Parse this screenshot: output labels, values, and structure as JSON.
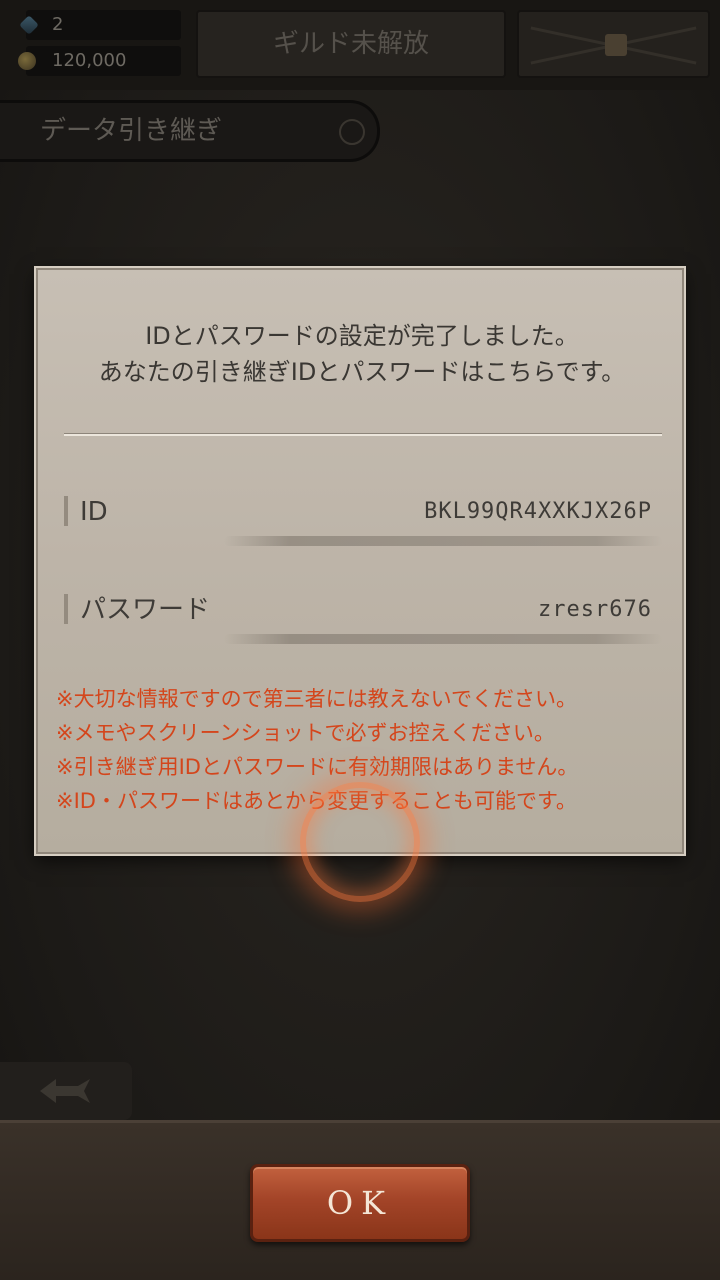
{
  "header": {
    "gems": "2",
    "gold": "120,000",
    "guild_label": "ギルド未解放"
  },
  "page_title": "データ引き継ぎ",
  "dialog": {
    "message_lines": [
      "IDとパスワードの設定が完了しました。",
      "あなたの引き継ぎIDとパスワードはこちらです。"
    ],
    "id_label": "ID",
    "id_value": "BKL99QR4XXKJX26P",
    "password_label": "パスワード",
    "password_value": "zresr676",
    "notes": [
      "※大切な情報ですので第三者には教えないでください。",
      "※メモやスクリーンショットで必ずお控えください。",
      "※引き継ぎ用IDとパスワードに有効期限はありません。",
      "※ID・パスワードはあとから変更することも可能です。"
    ],
    "note_color": "#d4461c"
  },
  "ok_button": {
    "label": "OK"
  },
  "icons": {
    "gem": "gem-icon",
    "gold": "gold-coin-icon",
    "lock": "lock-icon",
    "back": "back-arrow-icon"
  }
}
